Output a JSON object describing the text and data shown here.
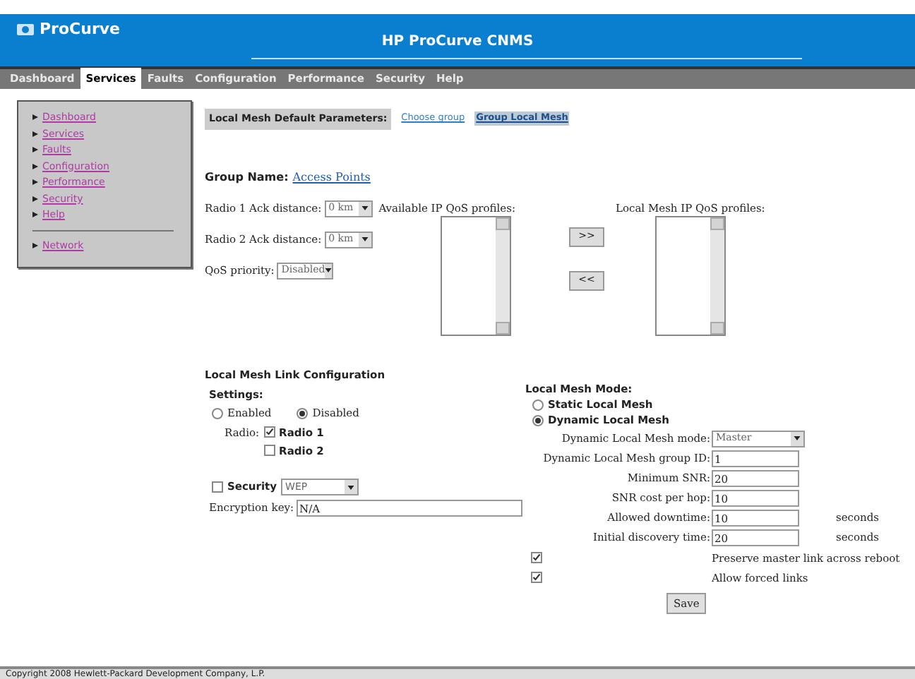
{
  "header": {
    "logo": "ProCurve",
    "title": "HP ProCurve CNMS"
  },
  "nav": [
    {
      "label": "Dashboard",
      "selected": false
    },
    {
      "label": "Services",
      "selected": true
    },
    {
      "label": "Faults",
      "selected": false
    },
    {
      "label": "Configuration",
      "selected": false
    },
    {
      "label": "Performance",
      "selected": false
    },
    {
      "label": "Security",
      "selected": false
    },
    {
      "label": "Help",
      "selected": false
    }
  ],
  "sidebar": {
    "items": [
      "Dashboard",
      "Services",
      "Faults",
      "Configuration",
      "Performance",
      "Security",
      "Help"
    ],
    "footer_items": [
      "Network"
    ]
  },
  "parameters": {
    "label": "Local Mesh Default Parameters:",
    "tabs": [
      {
        "label": "Choose group",
        "selected": false
      },
      {
        "label": "Group Local Mesh",
        "selected": true
      }
    ]
  },
  "group": {
    "label": "Group Name:",
    "value": "Access Points"
  },
  "fields": [
    {
      "label": "Radio 1 Ack distance:",
      "value": "0 km"
    },
    {
      "label": "Radio 2 Ack distance:",
      "value": "0 km"
    },
    {
      "label": "QoS priority:",
      "value": "Disabled"
    }
  ],
  "qos": {
    "available_label": "Available IP QoS profiles:",
    "local_label": "Local Mesh IP QoS profiles:",
    "buttons": [
      ">>",
      "<<"
    ]
  },
  "link_config": {
    "title": "Local Mesh Link Configuration",
    "settings_label": "Settings:",
    "states": [
      {
        "label": "Enabled",
        "selected": false
      },
      {
        "label": "Disabled",
        "selected": true
      }
    ],
    "radio_label": "Radio:",
    "radios": [
      {
        "label": "Radio 1",
        "checked": true
      },
      {
        "label": "Radio 2",
        "checked": false
      }
    ],
    "security": {
      "label": "Security",
      "checked": false,
      "value": "WEP"
    },
    "encryption": {
      "label": "Encryption key:",
      "value": "N/A"
    }
  },
  "mode": {
    "title": "Local Mesh Mode:",
    "options": [
      {
        "label": "Static Local Mesh",
        "selected": false
      },
      {
        "label": "Dynamic Local Mesh",
        "selected": true
      }
    ],
    "fields": [
      {
        "kind": "select",
        "label": "Dynamic Local Mesh mode:",
        "value": "Master"
      },
      {
        "kind": "text",
        "label": "Dynamic Local Mesh group ID:",
        "value": "1"
      },
      {
        "kind": "text",
        "label": "Minimum SNR:",
        "value": "20"
      },
      {
        "kind": "text",
        "label": "SNR cost per hop:",
        "value": "10"
      },
      {
        "kind": "text",
        "label": "Allowed downtime:",
        "value": "10",
        "unit": "seconds"
      },
      {
        "kind": "text",
        "label": "Initial discovery time:",
        "value": "20",
        "unit": "seconds"
      }
    ],
    "checks": [
      {
        "label": "Preserve master link across reboot",
        "checked": true
      },
      {
        "label": "Allow forced links",
        "checked": true
      }
    ]
  },
  "save": "Save",
  "footer": "Copyright 2008 Hewlett-Packard Development Company, L.P."
}
